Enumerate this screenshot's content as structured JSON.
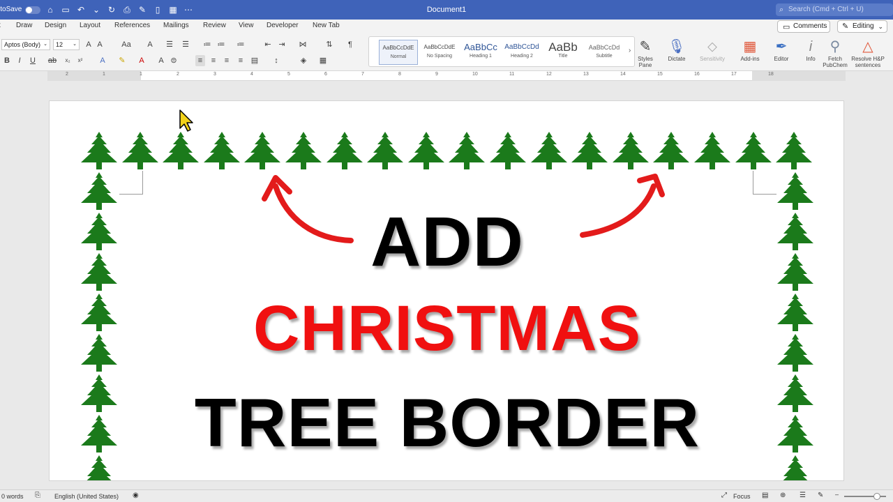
{
  "titlebar": {
    "autosave_label": "AutoSave",
    "doc_title": "Document1",
    "search_placeholder": "Search (Cmd + Ctrl + U)"
  },
  "tabs": [
    "Draw",
    "Design",
    "Layout",
    "References",
    "Mailings",
    "Review",
    "View",
    "Developer",
    "New Tab"
  ],
  "first_tab_fragment": "t",
  "comments_label": "Comments",
  "editing_label": "Editing",
  "ribbon": {
    "font_name": "Aptos (Body)",
    "font_size": "12",
    "styles": [
      {
        "sample": "AaBbCcDdE",
        "name": "Normal"
      },
      {
        "sample": "AaBbCcDdE",
        "name": "No Spacing"
      },
      {
        "sample": "AaBbCc",
        "name": "Heading 1"
      },
      {
        "sample": "AaBbCcDd",
        "name": "Heading 2"
      },
      {
        "sample": "AaBb",
        "name": "Title"
      },
      {
        "sample": "AaBbCcDd",
        "name": "Subtitle"
      }
    ],
    "styles_pane": "Styles Pane",
    "dictate": "Dictate",
    "sensitivity": "Sensitivity",
    "addins": "Add-ins",
    "editor": "Editor",
    "info": "Info",
    "fetch": "Fetch PubChem",
    "resolve": "Resolve H&P sentences"
  },
  "ruler_numbers": [
    "2",
    "1",
    "1",
    "2",
    "3",
    "4",
    "5",
    "6",
    "7",
    "8",
    "9",
    "10",
    "11",
    "12",
    "13",
    "14",
    "15",
    "16",
    "17",
    "18"
  ],
  "document": {
    "line1": "ADD",
    "line2": "CHRISTMAS",
    "line3": "TREE BORDER",
    "colors": {
      "black": "#000000",
      "red": "#f01010",
      "tree_green": "#1b7a1b",
      "arrow_red": "#e31b1b"
    }
  },
  "statusbar": {
    "words": "0 words",
    "language": "English (United States)",
    "focus": "Focus"
  },
  "icons": [
    "home-icon",
    "save-icon",
    "undo-icon",
    "redo-icon",
    "print-icon",
    "comments-icon",
    "pencil-icon",
    "microphone-icon",
    "editor-icon",
    "info-icon",
    "cursor-icon"
  ]
}
